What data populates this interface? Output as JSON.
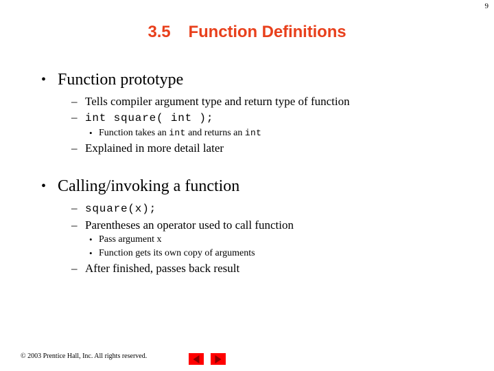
{
  "page": {
    "number": "9",
    "background_color": "#ffffff"
  },
  "title": {
    "number": "3.5",
    "text": "Function Definitions",
    "color": "#E8401C"
  },
  "content": {
    "sections": [
      {
        "heading": "Function prototype",
        "items": [
          {
            "level": 2,
            "kind": "text",
            "text": "Tells compiler argument type and return type of function"
          },
          {
            "level": 2,
            "kind": "code",
            "text": "int square( int );"
          },
          {
            "level": 3,
            "kind": "mixed",
            "parts": [
              {
                "mono": false,
                "text": "Function takes an "
              },
              {
                "mono": true,
                "text": "int"
              },
              {
                "mono": false,
                "text": " and returns an "
              },
              {
                "mono": true,
                "text": "int"
              }
            ]
          },
          {
            "level": 2,
            "kind": "text",
            "text": "Explained in more detail later"
          }
        ]
      },
      {
        "heading": "Calling/invoking a function",
        "items": [
          {
            "level": 2,
            "kind": "code",
            "text": "square(x);"
          },
          {
            "level": 2,
            "kind": "text",
            "text": "Parentheses an operator used to call function"
          },
          {
            "level": 3,
            "kind": "text",
            "text": "Pass argument x"
          },
          {
            "level": 3,
            "kind": "text",
            "text": "Function gets its own copy of arguments"
          },
          {
            "level": 2,
            "kind": "text",
            "text": "After finished, passes back result"
          }
        ]
      }
    ]
  },
  "bullets": {
    "level1": "•",
    "level2": "–",
    "level3": "•"
  },
  "footer": {
    "copyright": "© 2003 Prentice Hall, Inc.  All rights reserved.",
    "prev_label": "Previous slide",
    "next_label": "Next slide",
    "button_color": "#FF0000"
  }
}
